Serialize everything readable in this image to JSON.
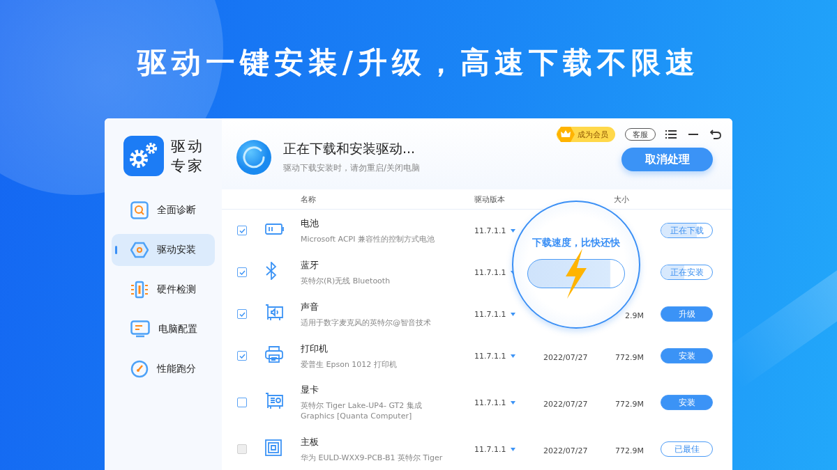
{
  "headline": "驱动一键安装/升级，高速下载不限速",
  "app": {
    "logo_lines": [
      "驱动",
      "专家"
    ],
    "nav": [
      {
        "label": "全面诊断",
        "selected": false
      },
      {
        "label": "驱动安装",
        "selected": true
      },
      {
        "label": "硬件检测",
        "selected": false
      },
      {
        "label": "电脑配置",
        "selected": false
      },
      {
        "label": "性能跑分",
        "selected": false
      }
    ],
    "top_bar": {
      "vip": "成为会员",
      "service": "客服"
    },
    "status": {
      "title": "正在下载和安装驱动...",
      "subtitle": "驱动下载安装时，请勿重启/关闭电脑",
      "cancel": "取消处理"
    },
    "table": {
      "columns": [
        "名称",
        "驱动版本",
        "",
        "大小"
      ],
      "rows": [
        {
          "name": "电池",
          "desc": "Microsoft ACPI 兼容性的控制方式电池",
          "version": "11.7.1.1",
          "date": "",
          "size": "",
          "action": "正在下载",
          "kind": "progress",
          "level": 0.7,
          "checked": true,
          "disabled": false
        },
        {
          "name": "蓝牙",
          "desc": "英特尔(R)无线 Bluetooth",
          "version": "11.7.1.1",
          "date": "",
          "size": "",
          "action": "正在安装",
          "kind": "progress",
          "level": 0.45,
          "checked": true,
          "disabled": false
        },
        {
          "name": "声音",
          "desc": "适用于数字麦克风的英特尔@智音技术",
          "version": "11.7.1.1",
          "date": "",
          "size": "2.9M",
          "action": "升级",
          "kind": "primary",
          "checked": true,
          "disabled": false
        },
        {
          "name": "打印机",
          "desc": "爱普生 Epson 1012 打印机",
          "version": "11.7.1.1",
          "date": "2022/07/27",
          "size": "772.9M",
          "action": "安装",
          "kind": "primary",
          "checked": true,
          "disabled": false
        },
        {
          "name": "显卡",
          "desc": "英特尔 Tiger Lake-UP4- GT2 集成 Graphics [Quanta Computer]",
          "version": "11.7.1.1",
          "date": "2022/07/27",
          "size": "772.9M",
          "action": "安装",
          "kind": "primary",
          "checked": false,
          "disabled": false
        },
        {
          "name": "主板",
          "desc": "华为 EULD-WXX9-PCB-B1 英特尔 Tiger",
          "version": "11.7.1.1",
          "date": "2022/07/27",
          "size": "772.9M",
          "action": "已最佳",
          "kind": "done",
          "checked": false,
          "disabled": true
        }
      ]
    },
    "magnifier": {
      "text": "下载速度，比快还快"
    }
  }
}
